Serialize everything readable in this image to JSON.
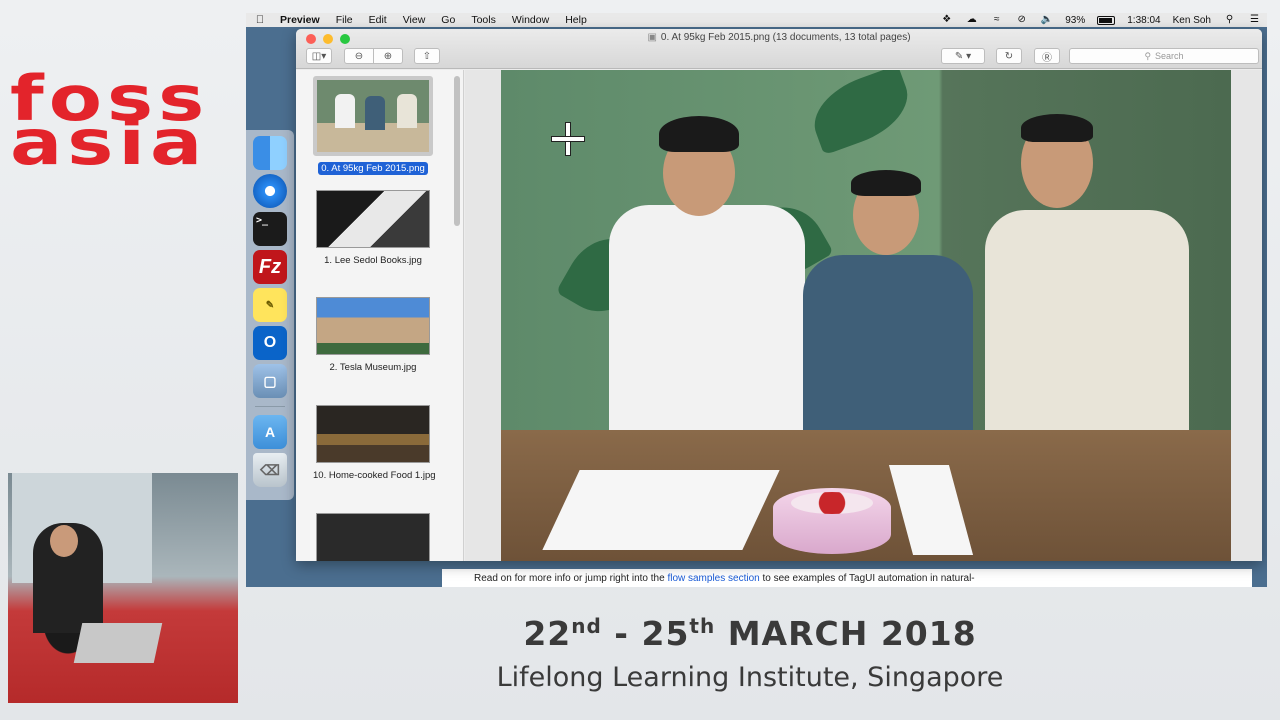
{
  "slide": {
    "logo_line1": "foss",
    "logo_line2": "asia",
    "dates": "22nd - 25th MARCH 2018",
    "venue": "Lifelong Learning Institute, Singapore"
  },
  "menubar": {
    "apple_icon": "apple-icon",
    "app_name": "Preview",
    "menus": [
      "File",
      "Edit",
      "View",
      "Go",
      "Tools",
      "Window",
      "Help"
    ],
    "battery": "93%",
    "clock": "1:38:04",
    "user": "Ken Soh"
  },
  "dock": {
    "apps": [
      "finder",
      "safari",
      "terminal",
      "filezilla",
      "stickies",
      "outlook",
      "preview",
      "applications",
      "trash"
    ]
  },
  "preview": {
    "title": "0. At 95kg Feb 2015.png (13 documents, 13 total pages)",
    "search_placeholder": "Search",
    "thumbnails": [
      {
        "label": "0. At 95kg Feb 2015.png"
      },
      {
        "label": "1. Lee Sedol Books.jpg"
      },
      {
        "label": "2. Tesla Museum.jpg"
      },
      {
        "label": "10. Home-cooked Food 1.jpg"
      },
      {
        "label": ""
      }
    ]
  },
  "browser": {
    "text_before": "Read on for more info or jump right into the ",
    "link": "flow samples section",
    "text_after": " to see examples of TagUI automation in natural-"
  },
  "colors": {
    "brand_red": "#e3242b",
    "selection_blue": "#1f62d6",
    "link_blue": "#1a5bd6"
  }
}
